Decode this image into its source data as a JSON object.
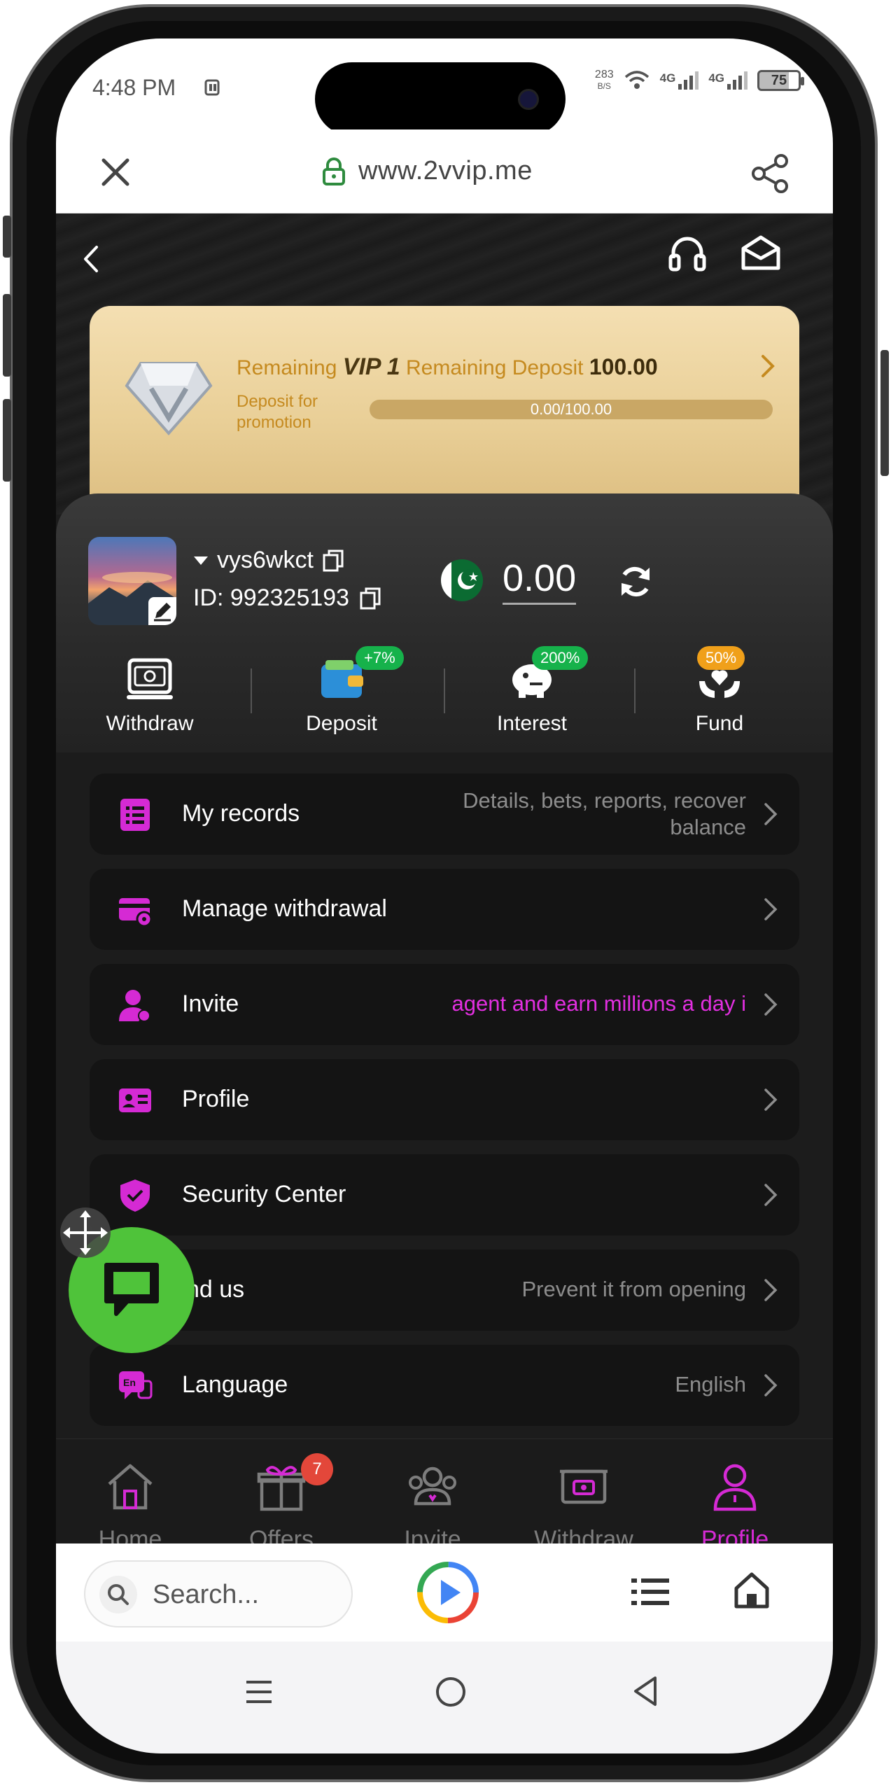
{
  "status_bar": {
    "time": "4:48 PM",
    "net_speed_value": "283",
    "net_speed_unit": "B/S",
    "signal_1": "4G",
    "signal_2": "4G",
    "battery": "75"
  },
  "url_bar": {
    "url": "www.2vvip.me"
  },
  "vip_card": {
    "prefix": "Remaining",
    "level": "VIP 1",
    "deposit_label": "Remaining Deposit",
    "deposit_amount": "100.00",
    "promo_text_line1": "Deposit for",
    "promo_text_line2": "promotion",
    "progress_text": "0.00/100.00",
    "progress_fraction": 0.0
  },
  "profile": {
    "username": "vys6wkct",
    "user_id": "ID: 992325193",
    "balance": "0.00"
  },
  "quick_actions": [
    {
      "label": "Withdraw",
      "badge": ""
    },
    {
      "label": "Deposit",
      "badge": "+7%"
    },
    {
      "label": "Interest",
      "badge": "200%"
    },
    {
      "label": "Fund",
      "badge": "50%"
    }
  ],
  "menu": [
    {
      "label": "My records",
      "value": "Details, bets, reports, recover balance",
      "icon": "records-icon"
    },
    {
      "label": "Manage withdrawal",
      "value": "",
      "icon": "withdrawal-card-icon"
    },
    {
      "label": "Invite",
      "value": "agent and earn millions a day i",
      "icon": "invite-person-icon"
    },
    {
      "label": "Profile",
      "value": "",
      "icon": "profile-card-icon"
    },
    {
      "label": "Security Center",
      "value": "",
      "icon": "shield-check-icon"
    },
    {
      "label": "nd us",
      "value": "Prevent it from opening",
      "icon": "find-us-icon"
    },
    {
      "label": "Language",
      "value": "English",
      "icon": "language-icon"
    }
  ],
  "tabbar": [
    {
      "label": "Home",
      "badge": ""
    },
    {
      "label": "Offers",
      "badge": "7"
    },
    {
      "label": "Invite",
      "badge": ""
    },
    {
      "label": "Withdraw",
      "badge": ""
    },
    {
      "label": "Profile",
      "badge": ""
    }
  ],
  "browser_bar": {
    "search_placeholder": "Search..."
  },
  "colors": {
    "accent_magenta": "#d52ad4",
    "gold": "#c58a1f",
    "green_badge": "#16b24b",
    "orange_badge": "#f0a01a",
    "chat_green": "#4fc33a"
  }
}
